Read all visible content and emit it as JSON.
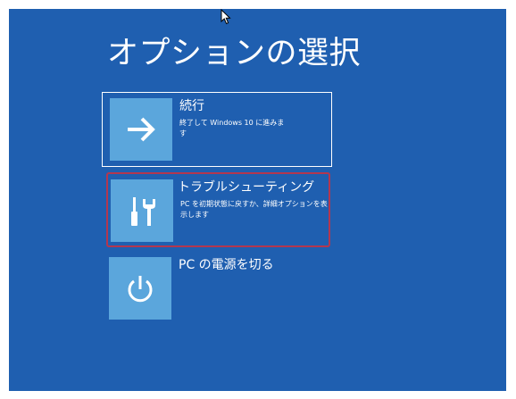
{
  "screen": {
    "title": "オプションの選択",
    "background_color": "#1f5fb0",
    "tile_color": "#5ba6dc",
    "highlight_color": "#b3374f"
  },
  "options": [
    {
      "title": "続行",
      "description": "終了して Windows 10 に進みます",
      "icon": "arrow-right-icon"
    },
    {
      "title": "トラブルシューティング",
      "description": "PC を初期状態に戻すか、詳細オプションを表示します",
      "icon": "tools-icon"
    },
    {
      "title": "PC の電源を切る",
      "description": "",
      "icon": "power-icon"
    }
  ]
}
